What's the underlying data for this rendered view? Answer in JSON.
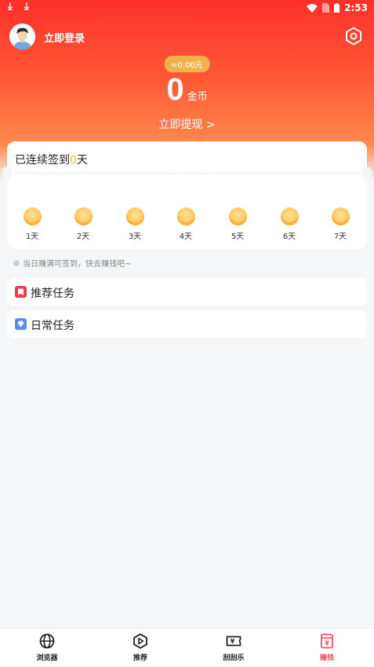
{
  "status_bar": {
    "time": "2:53"
  },
  "header": {
    "login_label": "立即登录"
  },
  "wallet": {
    "balance": "≈0.00元",
    "coins": "0",
    "coins_unit": "金币",
    "withdraw_label": "立即提现 >"
  },
  "checkin": {
    "title_prefix": "已连续签到",
    "days": "0",
    "title_suffix": "天",
    "day_labels": [
      "1天",
      "2天",
      "3天",
      "4天",
      "5天",
      "6天",
      "7天"
    ]
  },
  "hint": "当日赚满可签到，快去赚钱吧~",
  "tasks": {
    "recommended": "推荐任务",
    "daily": "日常任务"
  },
  "tabs": [
    {
      "label": "浏览器",
      "icon": "globe-icon"
    },
    {
      "label": "推荐",
      "icon": "play-icon"
    },
    {
      "label": "刮刮乐",
      "icon": "ticket-icon"
    },
    {
      "label": "赚钱",
      "icon": "money-icon"
    }
  ],
  "colors": {
    "accent": "#ff2f2c",
    "gold": "#f6b93b",
    "active_tab": "#f4515d"
  }
}
